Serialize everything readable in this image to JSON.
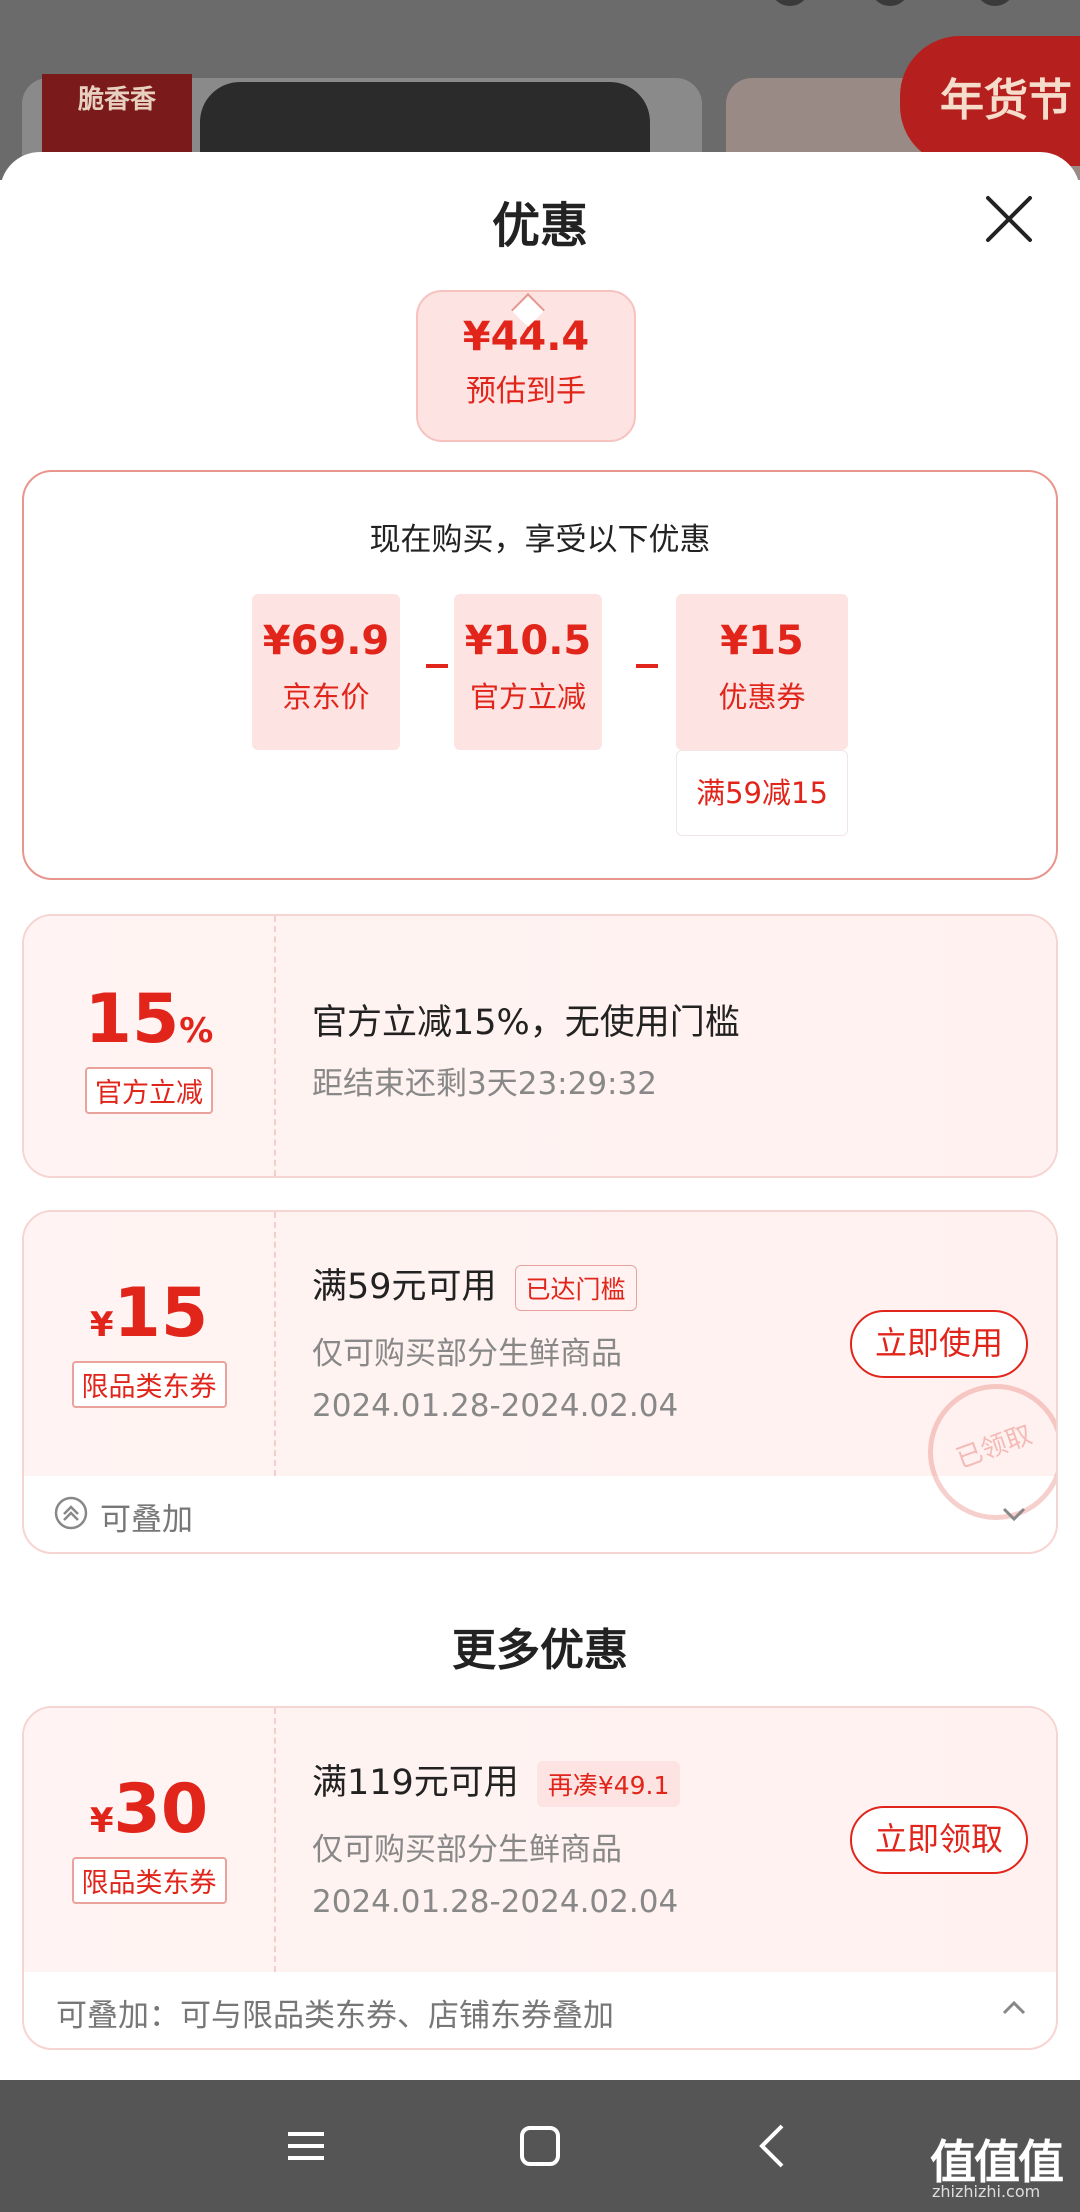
{
  "background": {
    "brand_text": "脆香香",
    "banner_text": "年货节"
  },
  "sheet": {
    "title": "优惠"
  },
  "estimate": {
    "price": "¥44.4",
    "label": "预估到手"
  },
  "calc": {
    "title": "现在购买，享受以下优惠",
    "items": [
      {
        "value": "¥69.9",
        "label": "京东价"
      },
      {
        "value": "¥10.5",
        "label": "官方立减"
      },
      {
        "value": "¥15",
        "label": "优惠券"
      }
    ],
    "condition": "满59减15"
  },
  "coupons": [
    {
      "amount": "15",
      "unit": "%",
      "tag": "官方立减",
      "title": "官方立减15%，无使用门槛",
      "line2": "距结束还剩3天23:29:32"
    },
    {
      "currency": "¥",
      "amount": "15",
      "tag": "限品类东券",
      "title": "满59元可用",
      "status": "已达门槛",
      "line2": "仅可购买部分生鲜商品",
      "line3": "2024.01.28-2024.02.04",
      "button": "立即使用",
      "stamp": "已领取",
      "footer": "可叠加"
    }
  ],
  "more": {
    "title": "更多优惠",
    "coupon": {
      "currency": "¥",
      "amount": "30",
      "tag": "限品类东券",
      "title": "满119元可用",
      "status": "再凑¥49.1",
      "line2": "仅可购买部分生鲜商品",
      "line3": "2024.01.28-2024.02.04",
      "button": "立即领取",
      "footer": "可叠加：可与限品类东券、店铺东券叠加"
    }
  },
  "watermark": {
    "text": "值值值",
    "url": "zhizhizhi.com"
  },
  "colors": {
    "accent": "#e1251b",
    "pink_bg": "#fde3e1"
  }
}
